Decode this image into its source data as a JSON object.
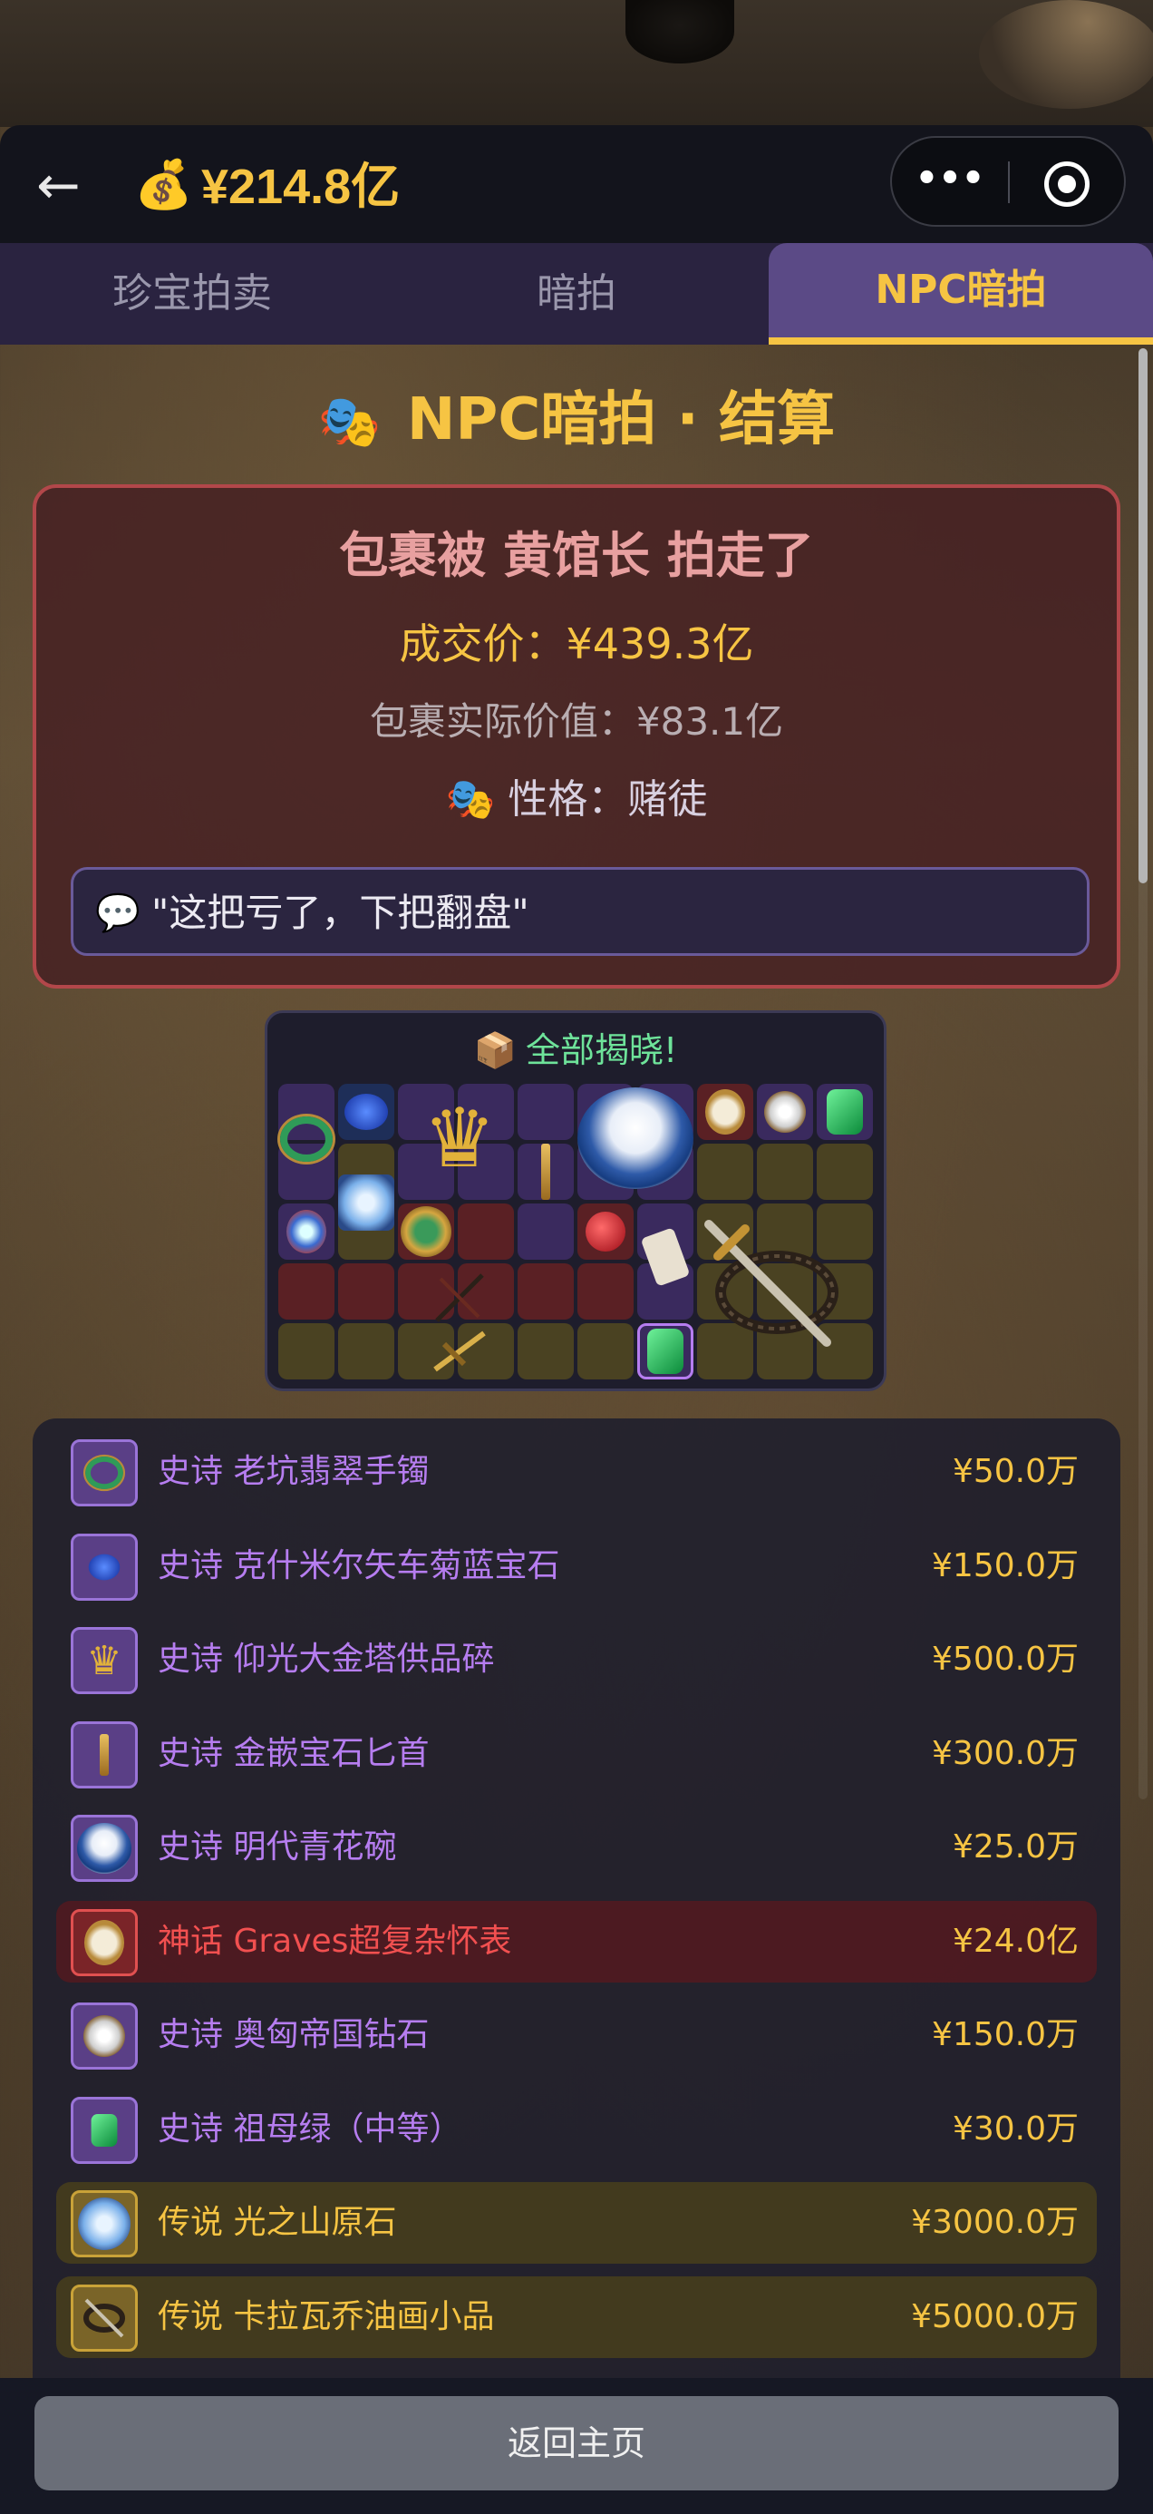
{
  "header": {
    "back_arrow": "←",
    "money_icon": "💰",
    "balance": "¥214.8亿",
    "more_glyph": "•••"
  },
  "tabs": [
    {
      "label": "珍宝拍卖",
      "active": false
    },
    {
      "label": "暗拍",
      "active": false
    },
    {
      "label": "NPC暗拍",
      "active": true
    }
  ],
  "page_title": {
    "emoji": "🎭",
    "text": "NPC暗拍 · 结算"
  },
  "result": {
    "title": "包裹被 黄馆长 拍走了",
    "deal_price": "成交价：¥439.3亿",
    "actual_value": "包裹实际价值：¥83.1亿",
    "personality_emoji": "🎭",
    "personality": "性格：赌徒",
    "quote_emoji": "💬",
    "quote": "\"这把亏了，下把翻盘\""
  },
  "reveal": {
    "emoji": "📦",
    "title": "全部揭晓!"
  },
  "items": [
    {
      "rarity": "史诗",
      "name": "老坑翡翠手镯",
      "price": "¥50.0万",
      "tier": "epic",
      "icon": "bangle-icon"
    },
    {
      "rarity": "史诗",
      "name": "克什米尔矢车菊蓝宝石",
      "price": "¥150.0万",
      "tier": "epic",
      "icon": "sapphire-icon"
    },
    {
      "rarity": "史诗",
      "name": "仰光大金塔供品碎",
      "price": "¥500.0万",
      "tier": "epic",
      "icon": "gold-fragment-icon"
    },
    {
      "rarity": "史诗",
      "name": "金嵌宝石匕首",
      "price": "¥300.0万",
      "tier": "epic",
      "icon": "dagger-icon"
    },
    {
      "rarity": "史诗",
      "name": "明代青花碗",
      "price": "¥25.0万",
      "tier": "epic",
      "icon": "porcelain-bowl-icon"
    },
    {
      "rarity": "神话",
      "name": "Graves超复杂怀表",
      "price": "¥24.0亿",
      "tier": "mythic",
      "icon": "pocket-watch-icon"
    },
    {
      "rarity": "史诗",
      "name": "奥匈帝国钻石",
      "price": "¥150.0万",
      "tier": "epic",
      "icon": "diamond-icon"
    },
    {
      "rarity": "史诗",
      "name": "祖母绿（中等）",
      "price": "¥30.0万",
      "tier": "epic",
      "icon": "emerald-icon"
    },
    {
      "rarity": "传说",
      "name": "光之山原石",
      "price": "¥3000.0万",
      "tier": "legend",
      "icon": "koh-i-noor-icon"
    },
    {
      "rarity": "传说",
      "name": "卡拉瓦乔油画小品",
      "price": "¥5000.0万",
      "tier": "legend",
      "icon": "painting-icon"
    }
  ],
  "footer": {
    "home_button": "返回主页"
  },
  "colors": {
    "gold": "#f6c443",
    "epic": "#b67df0",
    "mythic": "#f25050",
    "reveal_green": "#6ee39a"
  }
}
